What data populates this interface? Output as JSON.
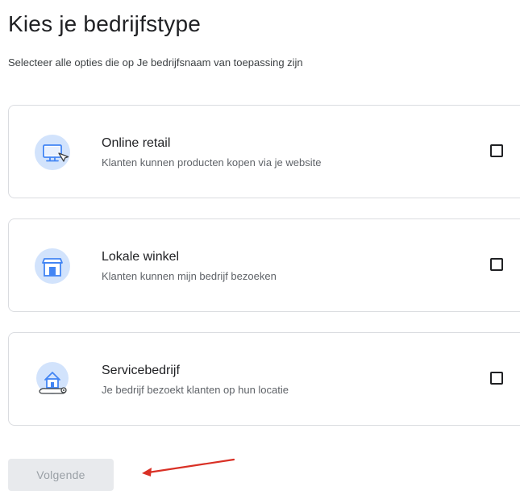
{
  "header": {
    "title": "Kies je bedrijfstype",
    "subtitle": "Selecteer alle opties die op Je bedrijfsnaam van toepassing zijn"
  },
  "options": [
    {
      "title": "Online retail",
      "description": "Klanten kunnen producten kopen via je website",
      "icon": "monitor-cursor-icon",
      "checked": false
    },
    {
      "title": "Lokale winkel",
      "description": "Klanten kunnen mijn bedrijf bezoeken",
      "icon": "storefront-icon",
      "checked": false
    },
    {
      "title": "Servicebedrijf",
      "description": "Je bedrijf bezoekt klanten op hun locatie",
      "icon": "house-map-pin-icon",
      "checked": false
    }
  ],
  "footer": {
    "next_label": "Volgende",
    "next_disabled": true
  },
  "colors": {
    "icon_bg": "#d2e3fc",
    "icon_fg": "#4285f4",
    "card_border": "#dadce0",
    "button_bg_disabled": "#e8eaed",
    "button_text_disabled": "#9aa0a6",
    "annotation_arrow": "#d93025"
  }
}
